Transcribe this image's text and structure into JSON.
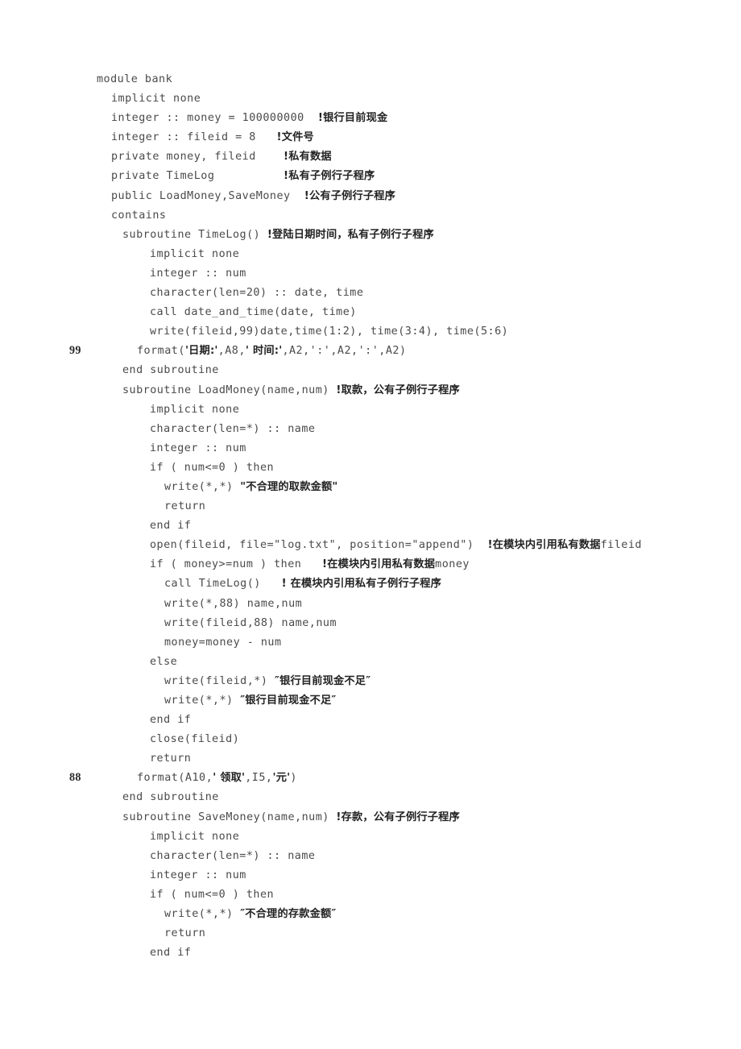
{
  "document": {
    "kind": "source-code-listing",
    "language": "Fortran",
    "module_name": "module bank",
    "background_color": "#ffffff",
    "code_color": "#4a4a4a",
    "comment_color": "#232323",
    "line_height_px": 24,
    "font_size_px": 13.4
  },
  "lines": [
    {
      "label": "",
      "indent": 0,
      "segments": [
        {
          "type": "code",
          "text": "module bank"
        }
      ]
    },
    {
      "label": "",
      "indent": 1,
      "segments": [
        {
          "type": "code",
          "text": "implicit none"
        }
      ]
    },
    {
      "label": "",
      "indent": 1,
      "segments": [
        {
          "type": "code",
          "text": "integer :: money = 100000000  "
        },
        {
          "type": "comment",
          "text": "!银行目前现金"
        }
      ]
    },
    {
      "label": "",
      "indent": 1,
      "segments": [
        {
          "type": "code",
          "text": "integer :: fileid = 8   "
        },
        {
          "type": "comment",
          "text": "!文件号"
        }
      ]
    },
    {
      "label": "",
      "indent": 1,
      "segments": [
        {
          "type": "code",
          "text": "private money, fileid    "
        },
        {
          "type": "comment",
          "text": "!私有数据"
        }
      ]
    },
    {
      "label": "",
      "indent": 1,
      "segments": [
        {
          "type": "code",
          "text": "private TimeLog          "
        },
        {
          "type": "comment",
          "text": "!私有子例行子程序"
        }
      ]
    },
    {
      "label": "",
      "indent": 1,
      "segments": [
        {
          "type": "code",
          "text": "public LoadMoney,SaveMoney  "
        },
        {
          "type": "comment",
          "text": "!公有子例行子程序"
        }
      ]
    },
    {
      "label": "",
      "indent": 1,
      "segments": [
        {
          "type": "code",
          "text": "contains"
        }
      ]
    },
    {
      "label": "",
      "indent": 2,
      "segments": [
        {
          "type": "code",
          "text": "subroutine TimeLog() "
        },
        {
          "type": "comment",
          "text": "!登陆日期时间，私有子例行子程序"
        }
      ]
    },
    {
      "label": "",
      "indent": 4,
      "segments": [
        {
          "type": "code",
          "text": "implicit none"
        }
      ]
    },
    {
      "label": "",
      "indent": 4,
      "segments": [
        {
          "type": "code",
          "text": "integer :: num"
        }
      ]
    },
    {
      "label": "",
      "indent": 4,
      "segments": [
        {
          "type": "code",
          "text": "character(len=20) :: date, time"
        }
      ]
    },
    {
      "label": "",
      "indent": 4,
      "segments": [
        {
          "type": "code",
          "text": "call date_and_time(date, time)"
        }
      ]
    },
    {
      "label": "",
      "indent": 4,
      "segments": [
        {
          "type": "code",
          "text": "write(fileid,99)date,time(1:2), time(3:4), time(5:6)"
        }
      ]
    },
    {
      "label": "99",
      "indent": 3,
      "segments": [
        {
          "type": "code",
          "text": "format("
        },
        {
          "type": "comment",
          "text": "'日期:'"
        },
        {
          "type": "code",
          "text": ",A8,"
        },
        {
          "type": "comment",
          "text": "' 时间:'"
        },
        {
          "type": "code",
          "text": ",A2,':',A2,':',A2)"
        }
      ]
    },
    {
      "label": "",
      "indent": 2,
      "segments": [
        {
          "type": "code",
          "text": "end subroutine"
        }
      ]
    },
    {
      "label": "",
      "indent": 2,
      "segments": [
        {
          "type": "code",
          "text": "subroutine LoadMoney(name,num) "
        },
        {
          "type": "comment",
          "text": "!取款，公有子例行子程序"
        }
      ]
    },
    {
      "label": "",
      "indent": 4,
      "segments": [
        {
          "type": "code",
          "text": "implicit none"
        }
      ]
    },
    {
      "label": "",
      "indent": 4,
      "segments": [
        {
          "type": "code",
          "text": "character(len=*) :: name"
        }
      ]
    },
    {
      "label": "",
      "indent": 4,
      "segments": [
        {
          "type": "code",
          "text": "integer :: num"
        }
      ]
    },
    {
      "label": "",
      "indent": 4,
      "segments": [
        {
          "type": "code",
          "text": "if ( num<=0 ) then"
        }
      ]
    },
    {
      "label": "",
      "indent": 5,
      "segments": [
        {
          "type": "code",
          "text": "write(*,*) "
        },
        {
          "type": "comment",
          "text": "\"不合理的取款金额\""
        }
      ]
    },
    {
      "label": "",
      "indent": 5,
      "segments": [
        {
          "type": "code",
          "text": "return"
        }
      ]
    },
    {
      "label": "",
      "indent": 4,
      "segments": [
        {
          "type": "code",
          "text": "end if"
        }
      ]
    },
    {
      "label": "",
      "indent": 4,
      "segments": [
        {
          "type": "code",
          "text": "open(fileid, file=\"log.txt\", position=\"append\")  "
        },
        {
          "type": "comment",
          "text": "!在模块内引用私有数据"
        },
        {
          "type": "code",
          "text": "fileid"
        }
      ]
    },
    {
      "label": "",
      "indent": 4,
      "segments": [
        {
          "type": "code",
          "text": "if ( money>=num ) then   "
        },
        {
          "type": "comment",
          "text": "!在模块内引用私有数据"
        },
        {
          "type": "code",
          "text": "money"
        }
      ]
    },
    {
      "label": "",
      "indent": 5,
      "segments": [
        {
          "type": "code",
          "text": "call TimeLog()   "
        },
        {
          "type": "comment",
          "text": "! 在模块内引用私有子例行子程序"
        }
      ]
    },
    {
      "label": "",
      "indent": 5,
      "segments": [
        {
          "type": "code",
          "text": "write(*,88) name,num"
        }
      ]
    },
    {
      "label": "",
      "indent": 5,
      "segments": [
        {
          "type": "code",
          "text": "write(fileid,88) name,num"
        }
      ]
    },
    {
      "label": "",
      "indent": 5,
      "segments": [
        {
          "type": "code",
          "text": "money=money - num"
        }
      ]
    },
    {
      "label": "",
      "indent": 4,
      "segments": [
        {
          "type": "code",
          "text": "else"
        }
      ]
    },
    {
      "label": "",
      "indent": 5,
      "segments": [
        {
          "type": "code",
          "text": "write(fileid,*) "
        },
        {
          "type": "comment",
          "text": "″银行目前现金不足″"
        }
      ]
    },
    {
      "label": "",
      "indent": 5,
      "segments": [
        {
          "type": "code",
          "text": "write(*,*) "
        },
        {
          "type": "comment",
          "text": "″银行目前现金不足″"
        }
      ]
    },
    {
      "label": "",
      "indent": 4,
      "segments": [
        {
          "type": "code",
          "text": "end if"
        }
      ]
    },
    {
      "label": "",
      "indent": 4,
      "segments": [
        {
          "type": "code",
          "text": "close(fileid)"
        }
      ]
    },
    {
      "label": "",
      "indent": 4,
      "segments": [
        {
          "type": "code",
          "text": "return"
        }
      ]
    },
    {
      "label": "88",
      "indent": 3,
      "segments": [
        {
          "type": "code",
          "text": "format(A10,"
        },
        {
          "type": "comment",
          "text": "' 领取'"
        },
        {
          "type": "code",
          "text": ",I5,"
        },
        {
          "type": "comment",
          "text": "'元'"
        },
        {
          "type": "code",
          "text": ")"
        }
      ]
    },
    {
      "label": "",
      "indent": 2,
      "segments": [
        {
          "type": "code",
          "text": "end subroutine"
        }
      ]
    },
    {
      "label": "",
      "indent": 2,
      "segments": [
        {
          "type": "code",
          "text": "subroutine SaveMoney(name,num) "
        },
        {
          "type": "comment",
          "text": "!存款，公有子例行子程序"
        }
      ]
    },
    {
      "label": "",
      "indent": 4,
      "segments": [
        {
          "type": "code",
          "text": "implicit none"
        }
      ]
    },
    {
      "label": "",
      "indent": 4,
      "segments": [
        {
          "type": "code",
          "text": "character(len=*) :: name"
        }
      ]
    },
    {
      "label": "",
      "indent": 4,
      "segments": [
        {
          "type": "code",
          "text": "integer :: num"
        }
      ]
    },
    {
      "label": "",
      "indent": 4,
      "segments": [
        {
          "type": "code",
          "text": "if ( num<=0 ) then"
        }
      ]
    },
    {
      "label": "",
      "indent": 5,
      "segments": [
        {
          "type": "code",
          "text": "write(*,*) "
        },
        {
          "type": "comment",
          "text": "″不合理的存款金额″"
        }
      ]
    },
    {
      "label": "",
      "indent": 5,
      "segments": [
        {
          "type": "code",
          "text": "return"
        }
      ]
    },
    {
      "label": "",
      "indent": 4,
      "segments": [
        {
          "type": "code",
          "text": "end if"
        }
      ]
    }
  ]
}
